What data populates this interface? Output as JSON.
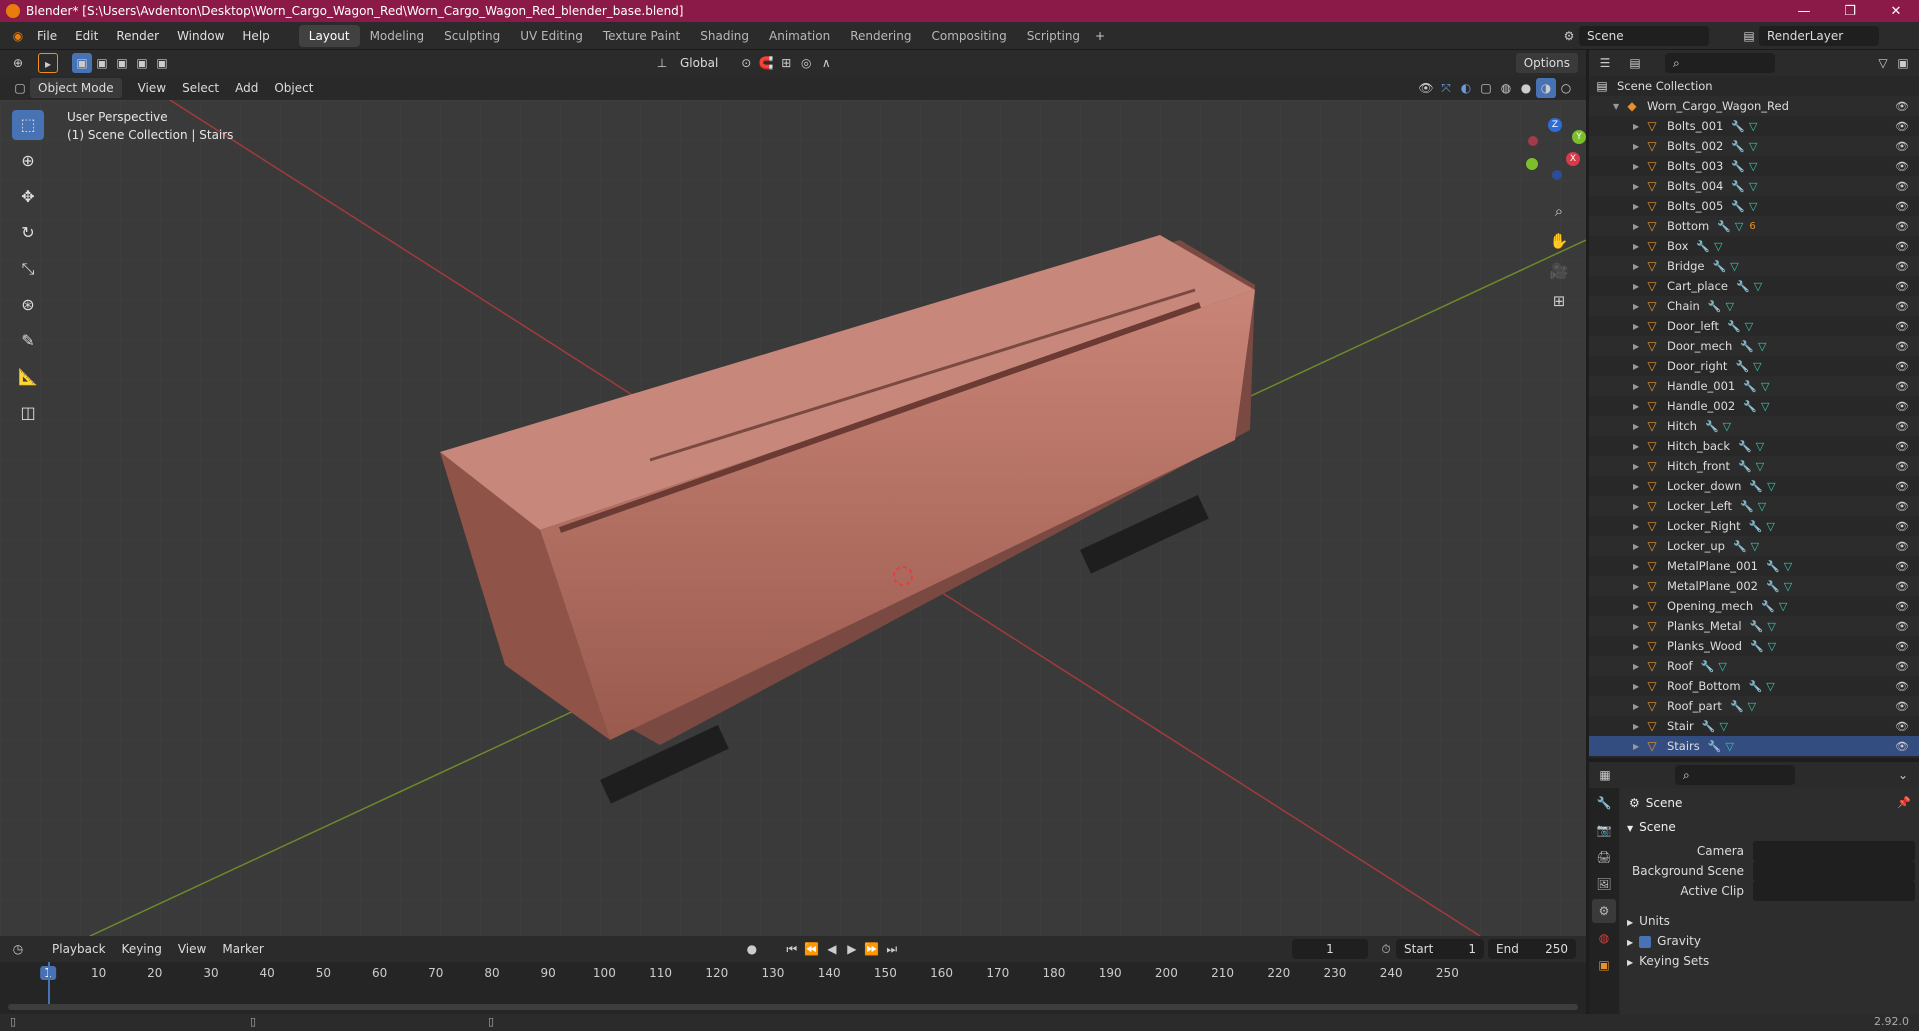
{
  "title": "Blender* [S:\\Users\\Avdenton\\Desktop\\Worn_Cargo_Wagon_Red\\Worn_Cargo_Wagon_Red_blender_base.blend]",
  "window_controls": [
    "—",
    "❐",
    "✕"
  ],
  "menus": [
    "File",
    "Edit",
    "Render",
    "Window",
    "Help"
  ],
  "workspaces": [
    "Layout",
    "Modeling",
    "Sculpting",
    "UV Editing",
    "Texture Paint",
    "Shading",
    "Animation",
    "Rendering",
    "Compositing",
    "Scripting"
  ],
  "scene_name": "Scene",
  "render_layer": "RenderLayer",
  "viewport": {
    "mode": "Object Mode",
    "menus": [
      "View",
      "Select",
      "Add",
      "Object"
    ],
    "transform_orientation": "Global",
    "options_label": "Options",
    "info_line1": "User Perspective",
    "info_line2": "(1) Scene Collection | Stairs",
    "gizmo_axes": [
      "Z",
      "Y",
      "X"
    ]
  },
  "outliner": {
    "root": "Scene Collection",
    "collection": "Worn_Cargo_Wagon_Red",
    "items": [
      {
        "name": "Bolts_001",
        "extra": ""
      },
      {
        "name": "Bolts_002",
        "extra": ""
      },
      {
        "name": "Bolts_003",
        "extra": ""
      },
      {
        "name": "Bolts_004",
        "extra": ""
      },
      {
        "name": "Bolts_005",
        "extra": ""
      },
      {
        "name": "Bottom",
        "extra": "6"
      },
      {
        "name": "Box",
        "extra": ""
      },
      {
        "name": "Bridge",
        "extra": ""
      },
      {
        "name": "Cart_place",
        "extra": ""
      },
      {
        "name": "Chain",
        "extra": ""
      },
      {
        "name": "Door_left",
        "extra": ""
      },
      {
        "name": "Door_mech",
        "extra": ""
      },
      {
        "name": "Door_right",
        "extra": ""
      },
      {
        "name": "Handle_001",
        "extra": ""
      },
      {
        "name": "Handle_002",
        "extra": ""
      },
      {
        "name": "Hitch",
        "extra": ""
      },
      {
        "name": "Hitch_back",
        "extra": ""
      },
      {
        "name": "Hitch_front",
        "extra": ""
      },
      {
        "name": "Locker_down",
        "extra": ""
      },
      {
        "name": "Locker_Left",
        "extra": ""
      },
      {
        "name": "Locker_Right",
        "extra": ""
      },
      {
        "name": "Locker_up",
        "extra": ""
      },
      {
        "name": "MetalPlane_001",
        "extra": ""
      },
      {
        "name": "MetalPlane_002",
        "extra": ""
      },
      {
        "name": "Opening_mech",
        "extra": ""
      },
      {
        "name": "Planks_Metal",
        "extra": ""
      },
      {
        "name": "Planks_Wood",
        "extra": ""
      },
      {
        "name": "Roof",
        "extra": ""
      },
      {
        "name": "Roof_Bottom",
        "extra": ""
      },
      {
        "name": "Roof_part",
        "extra": ""
      },
      {
        "name": "Stair",
        "extra": ""
      },
      {
        "name": "Stairs",
        "extra": ""
      }
    ]
  },
  "properties": {
    "header": "Scene",
    "panel": "Scene",
    "camera_label": "Camera",
    "background_label": "Background Scene",
    "clip_label": "Active Clip",
    "units_label": "Units",
    "gravity_label": "Gravity",
    "keying_label": "Keying Sets"
  },
  "timeline": {
    "menus": [
      "Playback",
      "Keying",
      "View",
      "Marker"
    ],
    "current_frame": "1",
    "start_label": "Start",
    "start": "1",
    "end_label": "End",
    "end": "250",
    "ticks": [
      "1",
      "10",
      "20",
      "30",
      "40",
      "50",
      "60",
      "70",
      "80",
      "90",
      "100",
      "110",
      "120",
      "130",
      "140",
      "150",
      "160",
      "170",
      "180",
      "190",
      "200",
      "210",
      "220",
      "230",
      "240",
      "250"
    ]
  },
  "version": "2.92.0"
}
